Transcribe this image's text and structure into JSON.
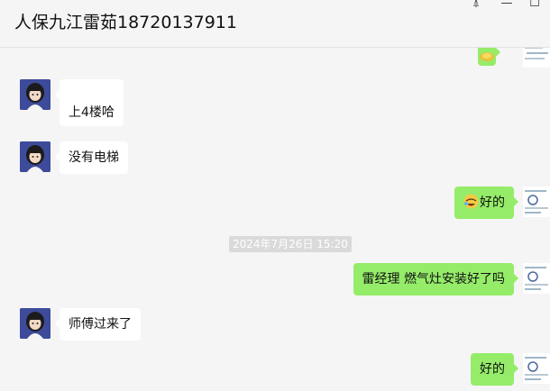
{
  "window": {
    "title": "人保九江雷茹18720137911",
    "pin_glyph": "⍋",
    "minimize_glyph": "—",
    "maximize_glyph": "☐"
  },
  "messages": [
    {
      "side": "out",
      "kind": "emoji",
      "text": ""
    },
    {
      "side": "in",
      "text": "上4楼哈"
    },
    {
      "side": "in",
      "text": "没有电梯"
    },
    {
      "side": "out",
      "emoji": "face-emoji",
      "text": "好的"
    },
    {
      "side": "system",
      "text": "2024年7月26日 15:20"
    },
    {
      "side": "out",
      "text": "雷经理 燃气灶安装好了吗"
    },
    {
      "side": "in",
      "text": "师傅过来了"
    },
    {
      "side": "out",
      "text": "好的"
    }
  ],
  "colors": {
    "background": "#f5f5f5",
    "incoming_bubble": "#ffffff",
    "outgoing_bubble": "#95ec69",
    "avatar_bg": "#3d4b9a"
  }
}
